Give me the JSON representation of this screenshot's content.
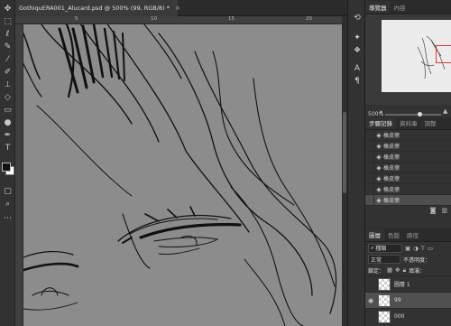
{
  "document": {
    "tab_title": "GothiquERA001_Alucard.psd @ 500% (99, RGB/8) *",
    "close_glyph": "×"
  },
  "rulers": {
    "top": [
      "5",
      "10",
      "15",
      "20"
    ]
  },
  "toolbar": {
    "tools": [
      "move-icon",
      "marquee-icon",
      "lasso-icon",
      "quick-select-icon",
      "eyedropper-icon",
      "brush-icon",
      "stamp-icon",
      "history-brush-icon",
      "eraser-icon",
      "gradient-icon",
      "blur-icon",
      "dodge-icon",
      "pen-icon",
      "type-icon",
      "path-select-icon",
      "shape-icon",
      "hand-icon",
      "zoom-icon",
      "more-icon"
    ]
  },
  "navigator": {
    "tabs": [
      "導覽器",
      "內容"
    ],
    "zoom": "500%"
  },
  "history": {
    "tabs": [
      "步驟記錄",
      "資料庫",
      "調整"
    ],
    "items": [
      "橡皮擦",
      "橡皮擦",
      "橡皮擦",
      "橡皮擦",
      "橡皮擦",
      "橡皮擦",
      "橡皮擦"
    ],
    "selected_index": 6
  },
  "layers": {
    "tabs": [
      "圖層",
      "色版",
      "路徑"
    ],
    "filter_label": "種類",
    "blend_mode": "正常",
    "opacity_label": "不透明度：",
    "lock_label": "鎖定：",
    "fill_label": "填滿：",
    "items": [
      {
        "name": "圖層 1",
        "visible": false
      },
      {
        "name": "99",
        "visible": true
      },
      {
        "name": "000",
        "visible": false
      }
    ],
    "selected_index": 1
  },
  "colors": {
    "canvas_bg": "#8c8c8c",
    "ink": "#111111",
    "selection_red": "#e33333"
  }
}
